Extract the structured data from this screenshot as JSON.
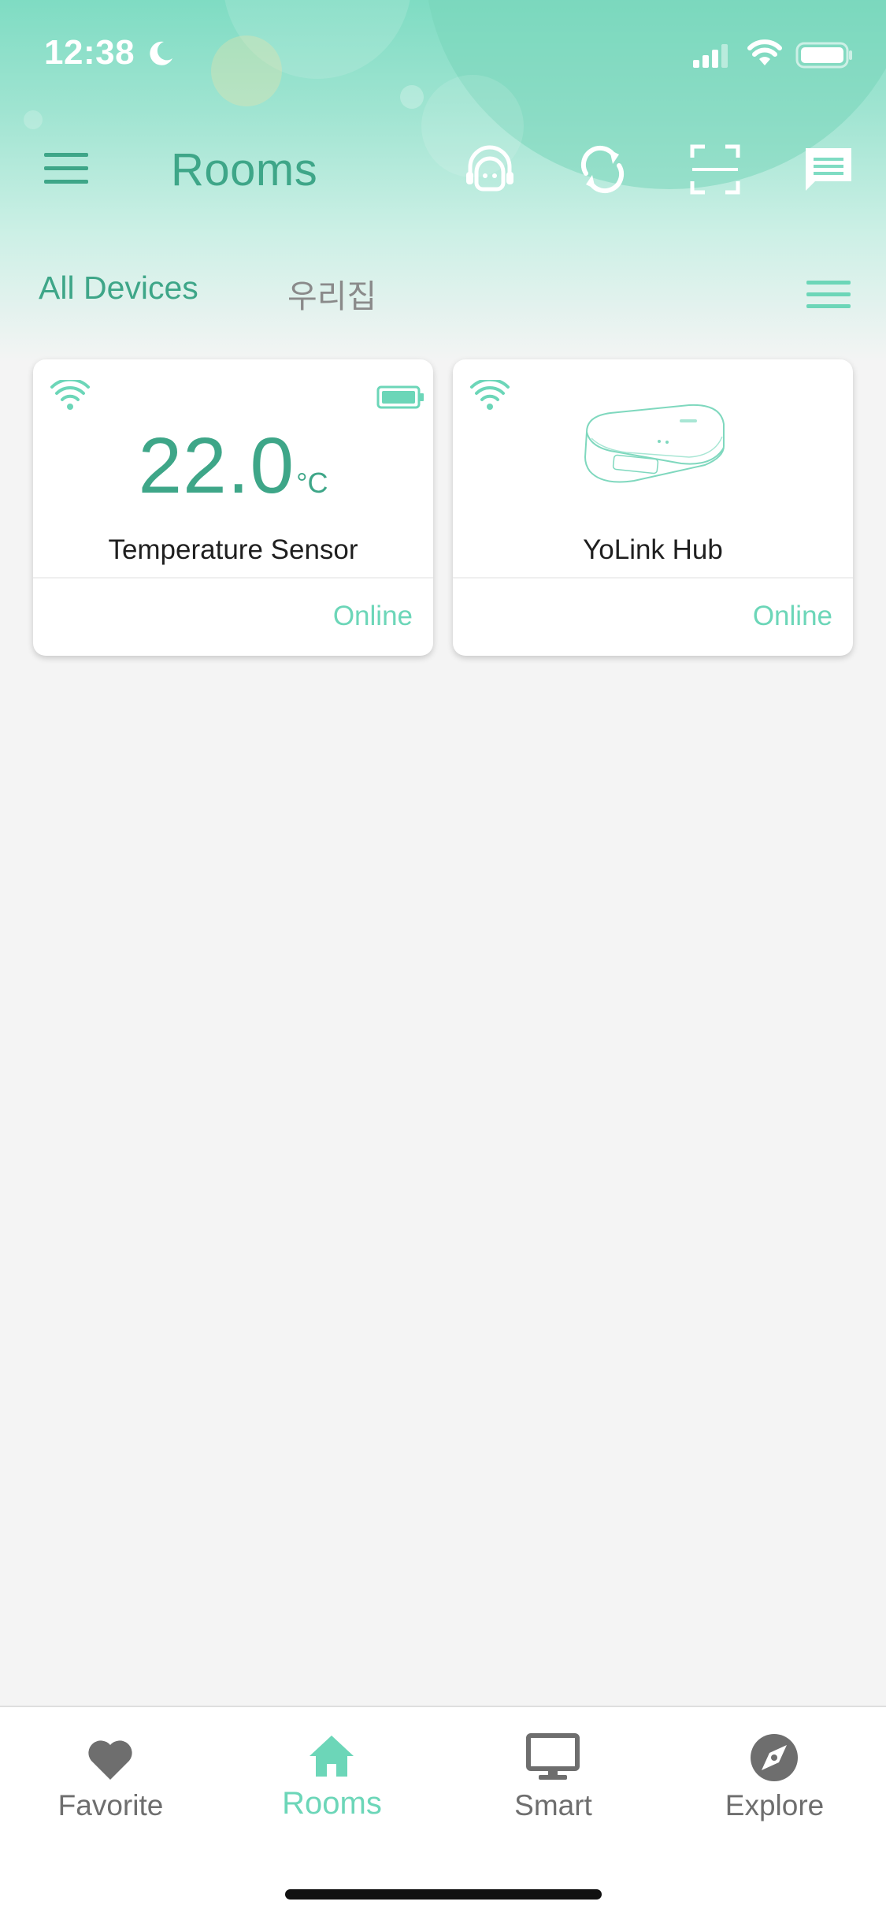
{
  "status_bar": {
    "time": "12:38"
  },
  "header": {
    "title": "Rooms",
    "icons": [
      "menu-icon",
      "customer-support-icon",
      "sync-icon",
      "scan-icon",
      "message-icon"
    ]
  },
  "room_tabs": [
    {
      "label": "All Devices",
      "active": true
    },
    {
      "label": "우리집",
      "active": false
    }
  ],
  "devices": [
    {
      "name": "Temperature Sensor",
      "value": "22.0",
      "unit": "°C",
      "status": "Online",
      "signal": "wifi-icon",
      "battery": "battery-full-icon"
    },
    {
      "name": "YoLink Hub",
      "status": "Online",
      "signal": "wifi-icon",
      "image": "hub-device-image"
    }
  ],
  "tab_bar": [
    {
      "label": "Favorite",
      "icon": "heart-icon",
      "active": false
    },
    {
      "label": "Rooms",
      "icon": "home-icon",
      "active": true
    },
    {
      "label": "Smart",
      "icon": "monitor-icon",
      "active": false
    },
    {
      "label": "Explore",
      "icon": "compass-icon",
      "active": false
    }
  ],
  "colors": {
    "accent": "#3ea688",
    "accent_light": "#6cd6b8",
    "header_gradient_top": "#7fdcc3",
    "background": "#f4f4f4",
    "inactive": "#6e6e6e"
  }
}
